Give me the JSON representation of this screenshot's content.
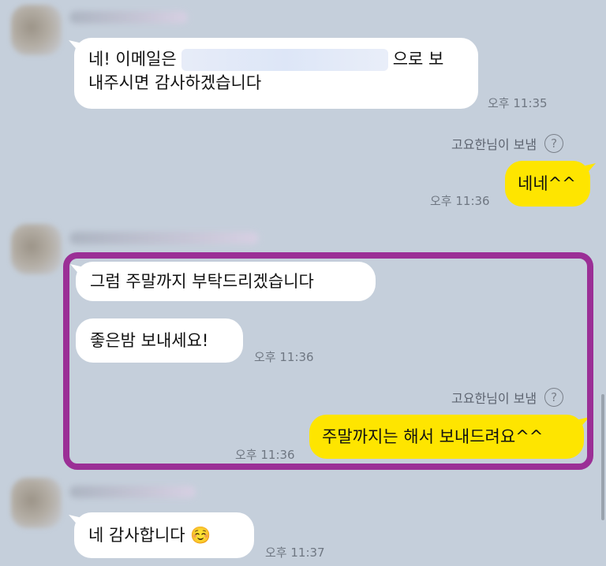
{
  "messages": {
    "m1": {
      "line1_pre": "네! 이메일은",
      "line1_post": "으로 보",
      "line2": "내주시면 감사하겠습니다",
      "time": "오후 11:35"
    },
    "sent1": {
      "sender_label": "고요한님이 보냄",
      "help_glyph": "?",
      "text": "네네^^",
      "time": "오후 11:36"
    },
    "m2": {
      "text": "그럼 주말까지 부탁드리겠습니다"
    },
    "m3": {
      "text": "좋은밤 보내세요!",
      "time": "오후 11:36"
    },
    "sent2": {
      "sender_label": "고요한님이 보냄",
      "help_glyph": "?",
      "text": "주말까지는 해서 보내드려요^^",
      "time": "오후 11:36"
    },
    "m4": {
      "text": "네 감사합니다 ☺️",
      "time": "오후 11:37"
    }
  },
  "colors": {
    "background": "#c5cfdb",
    "received_bubble": "#ffffff",
    "sent_bubble": "#fee500",
    "highlight_border": "#9b2f96"
  },
  "icons": {
    "help": "question-circle-icon",
    "avatar": "blurred-avatar"
  }
}
